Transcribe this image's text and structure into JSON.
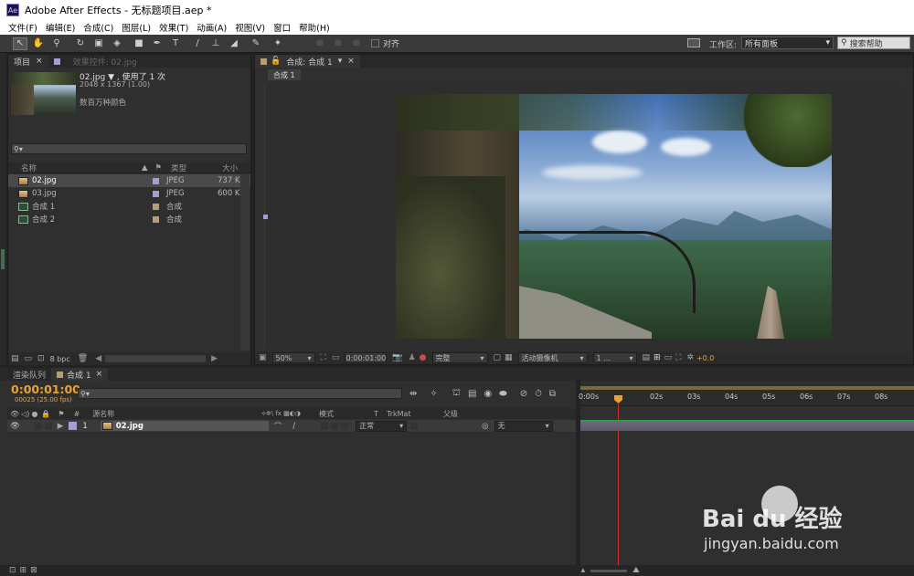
{
  "window": {
    "title": "Adobe After Effects - 无标题项目.aep *",
    "logo": "Ae"
  },
  "menu": [
    "文件(F)",
    "编辑(E)",
    "合成(C)",
    "图层(L)",
    "效果(T)",
    "动画(A)",
    "视图(V)",
    "窗口",
    "帮助(H)"
  ],
  "toolbar": {
    "align_label": "对齐",
    "workspace_label": "工作区:",
    "workspace_value": "所有面板",
    "search_placeholder": "搜索帮助"
  },
  "project": {
    "tab_label": "项目",
    "effects_tab_label": "效果控件: 02.jpg",
    "asset": {
      "name": "02.jpg ▼ , 使用了 1 次",
      "dims": "2048 x 1367 (1.00)",
      "color": "数百万种颜色"
    },
    "search": "⚲▾",
    "columns": {
      "name": "名称",
      "type": "类型",
      "size": "大小"
    },
    "items": [
      {
        "name": "02.jpg",
        "type": "JPEG",
        "size": "737 K",
        "selected": true,
        "kind": "image",
        "tag": "#9fa0d8"
      },
      {
        "name": "03.jpg",
        "type": "JPEG",
        "size": "600 K",
        "selected": false,
        "kind": "image",
        "tag": "#9fa0d8"
      },
      {
        "name": "合成 1",
        "type": "合成",
        "size": "",
        "selected": false,
        "kind": "comp",
        "tag": "#b79e72"
      },
      {
        "name": "合成 2",
        "type": "合成",
        "size": "",
        "selected": false,
        "kind": "comp",
        "tag": "#b79e72"
      }
    ],
    "bpc": "8 bpc"
  },
  "viewer": {
    "tab_label": "合成: 合成 1",
    "breadcrumb": "合成 1",
    "zoom": "50%",
    "timecode": "0:00:01:00",
    "quality": "完整",
    "camera": "活动摄像机",
    "views": "1 ...",
    "exposure": "+0.0"
  },
  "timeline": {
    "render_tab": "渲染队列",
    "comp_tab": "合成 1",
    "timecode": "0:00:01:00",
    "fps": "00025 (25.00 fps)",
    "search": "⚲▾",
    "col_source": "源名称",
    "col_mode": "模式",
    "col_t": "T",
    "col_trkmat": "TrkMat",
    "col_parent": "父级",
    "col_num": "#",
    "layer": {
      "num": "1",
      "name": "02.jpg",
      "mode": "正常",
      "parent": "无"
    },
    "ticks": [
      "0:00s",
      "02s",
      "03s",
      "04s",
      "05s",
      "06s",
      "07s",
      "08s"
    ]
  },
  "watermark": {
    "brand": "Bai du 经验",
    "url": "jingyan.baidu.com"
  }
}
